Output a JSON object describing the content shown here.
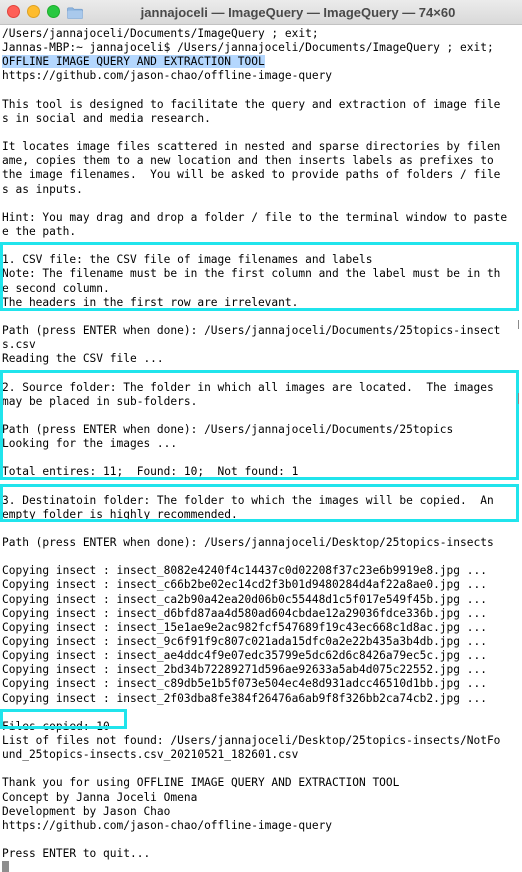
{
  "window": {
    "title": "jannajoceli — ImageQuery — ImageQuery — 74×60"
  },
  "terminal": {
    "lines": [
      "/Users/jannajoceli/Documents/ImageQuery ; exit;",
      "Jannas-MBP:~ jannajoceli$ /Users/jannajoceli/Documents/ImageQuery ; exit;",
      "OFFLINE IMAGE QUERY AND EXTRACTION TOOL",
      "https://github.com/jason-chao/offline-image-query",
      "",
      "This tool is designed to facilitate the query and extraction of image file",
      "s in social and media research.",
      "",
      "It locates image files scattered in nested and sparse directories by filen",
      "ame, copies them to a new location and then inserts labels as prefixes to",
      "the image filenames.  You will be asked to provide paths of folders / file",
      "s as inputs.",
      "",
      "Hint: You may drag and drop a folder / file to the terminal window to paste",
      "e the path.",
      "",
      "1. CSV file: the CSV file of image filenames and labels",
      "Note: The filename must be in the first column and the label must be in th",
      "e second column.",
      "The headers in the first row are irrelevant.",
      "",
      "Path (press ENTER when done): /Users/jannajoceli/Documents/25topics-insect",
      "s.csv",
      "Reading the CSV file ...",
      "",
      "2. Source folder: The folder in which all images are located.  The images",
      "may be placed in sub-folders.",
      "",
      "Path (press ENTER when done): /Users/jannajoceli/Documents/25topics",
      "Looking for the images ...",
      "",
      "Total entires: 11;  Found: 10;  Not found: 1",
      "",
      "3. Destinatoin folder: The folder to which the images will be copied.  An",
      "empty folder is highly recommended.",
      "",
      "Path (press ENTER when done): /Users/jannajoceli/Desktop/25topics-insects",
      "",
      "Copying insect : insect_8082e4240f4c14437c0d02208f37c23e6b9919e8.jpg ...",
      "Copying insect : insect_c66b2be02ec14cd2f3b01d9480284d4af22a8ae0.jpg ...",
      "Copying insect : insect_ca2b90a42ea20d06b0c55448d1c5f017e549f45b.jpg ...",
      "Copying insect : insect_d6bfd87aa4d580ad604cbdae12a29036fdce336b.jpg ...",
      "Copying insect : insect_15e1ae9e2ac982fcf547689f19c43ec668c1d8ac.jpg ...",
      "Copying insect : insect_9c6f91f9c807c021ada15dfc0a2e22b435a3b4db.jpg ...",
      "Copying insect : insect_ae4ddc4f9e07edc35799e5dc62d6c8426a79ec5c.jpg ...",
      "Copying insect : insect_2bd34b72289271d596ae92633a5ab4d075c22552.jpg ...",
      "Copying insect : insect_c89db5e1b5f073e504ec4e8d931adcc46510d1bb.jpg ...",
      "Copying insect : insect_2f03dba8fe384f26476a6ab9f8f326bb2ca74cb2.jpg ...",
      "",
      "Files copied: 10",
      "List of files not found: /Users/jannajoceli/Desktop/25topics-insects/NotFo",
      "und_25topics-insects.csv_20210521_182601.csv",
      "",
      "Thank you for using OFFLINE IMAGE QUERY AND EXTRACTION TOOL",
      "Concept by Janna Joceli Omena",
      "Development by Jason Chao",
      "https://github.com/jason-chao/offline-image-query",
      "",
      "Press ENTER to quit..."
    ],
    "selected_line": 2
  },
  "colors": {
    "highlight_box": "#20e4ec",
    "selection": "#b4d7fe"
  }
}
